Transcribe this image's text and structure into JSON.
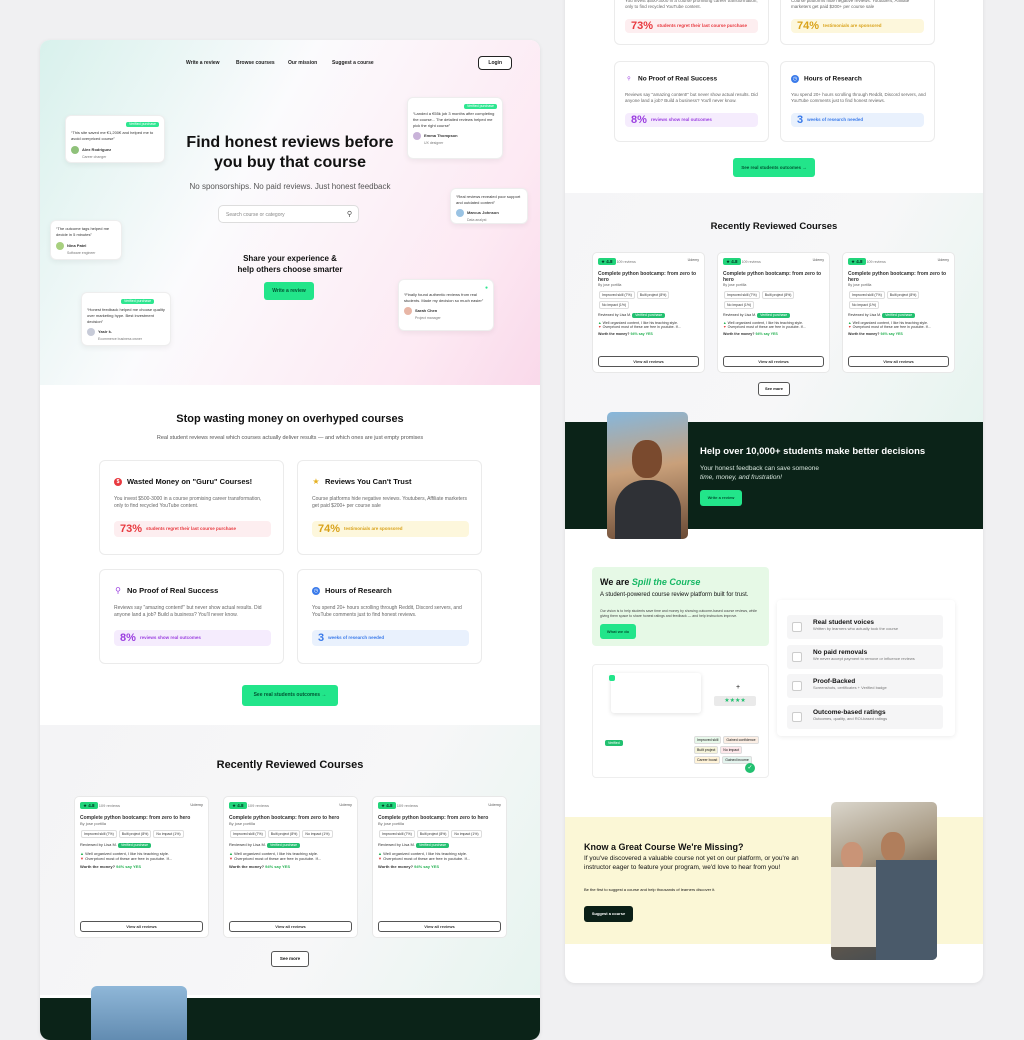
{
  "nav": {
    "items": [
      "Write a review",
      "Browse courses",
      "Our mission",
      "Suggest a course"
    ],
    "login": "Login"
  },
  "hero": {
    "title_line1": "Find honest reviews before",
    "title_line2": "you buy that course",
    "subtitle": "No sponsorships. No paid reviews. Just honest feedback",
    "search_placeholder": "Search course or category",
    "share_line1": "Share your experience &",
    "share_line2": "help others choose smarter",
    "cta": "Write a review"
  },
  "floating_reviews": [
    {
      "badge": "Verified purchase",
      "quote": "“This site saved me €1,200€ and helped me to avoid overpriced course”",
      "name": "Alex Rodriguez",
      "role": "Career changer"
    },
    {
      "badge": "Verified purchase",
      "quote": "“Landed a €55k job 3 months after completing the course... The detailed reviews helped me pick the right course”",
      "name": "Emma Thompson",
      "role": "UX designer"
    },
    {
      "badge": "",
      "quote": "“Real reviews revealed poor support and outdated content”",
      "name": "Marcus Johnson",
      "role": "Data analyst"
    },
    {
      "badge": "",
      "quote": "“The outcome tags helped me decide in 5 minutes”",
      "name": "Nina Patel",
      "role": "Software engineer"
    },
    {
      "badge": "Verified purchase",
      "quote": "“Honest feedback helped me choose quality over marketing hype. Best investment decision”",
      "name": "Yasir k.",
      "role": "Ecommerce business owner"
    },
    {
      "badge": "",
      "quote": "“Finally found authentic reviews from real students. Made my decision so much easier”",
      "name": "Sarah Chen",
      "role": "Project manager"
    }
  ],
  "problems": {
    "title": "Stop wasting money on overhyped courses",
    "subtitle": "Real student reviews reveal which courses actually deliver results — and which ones are just empty promises",
    "cards": [
      {
        "title": "Wasted Money on \"Guru\" Courses!",
        "desc": "You invest $500-3000 in a course promising career transformation, only to find recycled YouTube content.",
        "stat": "73%",
        "stat_text": "students regret their last course purchase",
        "color": "#e8393f",
        "bg": "#fdeef0"
      },
      {
        "title": "Reviews You Can't Trust",
        "desc": "Course platforms hide negative reviews. Youtubers, Affiliate marketers get paid $200+ per course sale",
        "stat": "74%",
        "stat_text": "testimonials are sponsored",
        "color": "#d9a21a",
        "bg": "#fdf7dc"
      },
      {
        "title": "No Proof of Real Success",
        "desc": "Reviews say \"amazing content!\" but never show actual results. Did anyone land a job? Build a business? You'll never know.",
        "stat": "8%",
        "stat_text": "reviews show real outcomes",
        "color": "#9b3fe0",
        "bg": "#f5ecfd"
      },
      {
        "title": "Hours of Research",
        "desc": "You spend 20+ hours scrolling through Reddit, Discord servers, and YouTube comments just to find honest reviews.",
        "stat": "3",
        "stat_text": "weeks of research needed",
        "color": "#3b7bea",
        "bg": "#e9f1fd"
      }
    ],
    "cta": "See real students outcomes  →"
  },
  "recent": {
    "title": "Recently Reviewed Courses",
    "course": {
      "rating": "4.8",
      "reviews": "109 reviews",
      "platform": "Udemy",
      "title": "Complete python bootcamp: from zero to hero",
      "author": "By jose portilla",
      "tags": [
        "Improved skill (7%)",
        "Built project (8%)",
        "No impact (1%)"
      ],
      "reviewed_by": "Reviewed by Lisa M.",
      "verified": "Verified purchase",
      "pro": "Well organized content, I like his teaching style.",
      "con": "Overpriced most of these are free in youtube. If...",
      "worth": "Worth the money?",
      "worth_val": "94% say YES",
      "view_all": "View all reviews"
    },
    "see_more": "See more"
  },
  "help": {
    "title": "Help over 10,000+ students make better decisions",
    "line1": "Your honest feedback can save someone",
    "line2": "time, money, and frustration!",
    "cta": "Write a review"
  },
  "about": {
    "we_are": "We are",
    "brand": "Spill the Course",
    "lead": "A student-powered course review platform built for trust.",
    "desc": "Our vision is to help students save time and money by showing outcome-based course reviews, while giving them space to share honest ratings and feedback — and help instructors improve.",
    "cta": "What we do",
    "features": [
      {
        "title": "Real student voices",
        "desc": "Written by learners who actually took the course"
      },
      {
        "title": "No paid removals",
        "desc": "We never accept payment to remove or influence reviews"
      },
      {
        "title": "Proof-Backed",
        "desc": "Screenshots, certificates + Verified badge"
      },
      {
        "title": "Outcome-based ratings",
        "desc": "Outcomes, quality, and ROI-based ratings"
      }
    ],
    "mock_tags": [
      "Improved skill",
      "Gained confidence",
      "Built project",
      "No impact",
      "Career boost",
      "Gained income"
    ],
    "mock_verified": "Verified"
  },
  "suggest": {
    "title": "Know a Great Course We're Missing?",
    "desc": "If you've discovered a valuable course not yet on our platform, or you're an instructor eager to feature your program, we'd love to hear from you!",
    "small": "Be the first to suggest a course and help thousands of learners discover it.",
    "cta": "Suggest a course"
  }
}
